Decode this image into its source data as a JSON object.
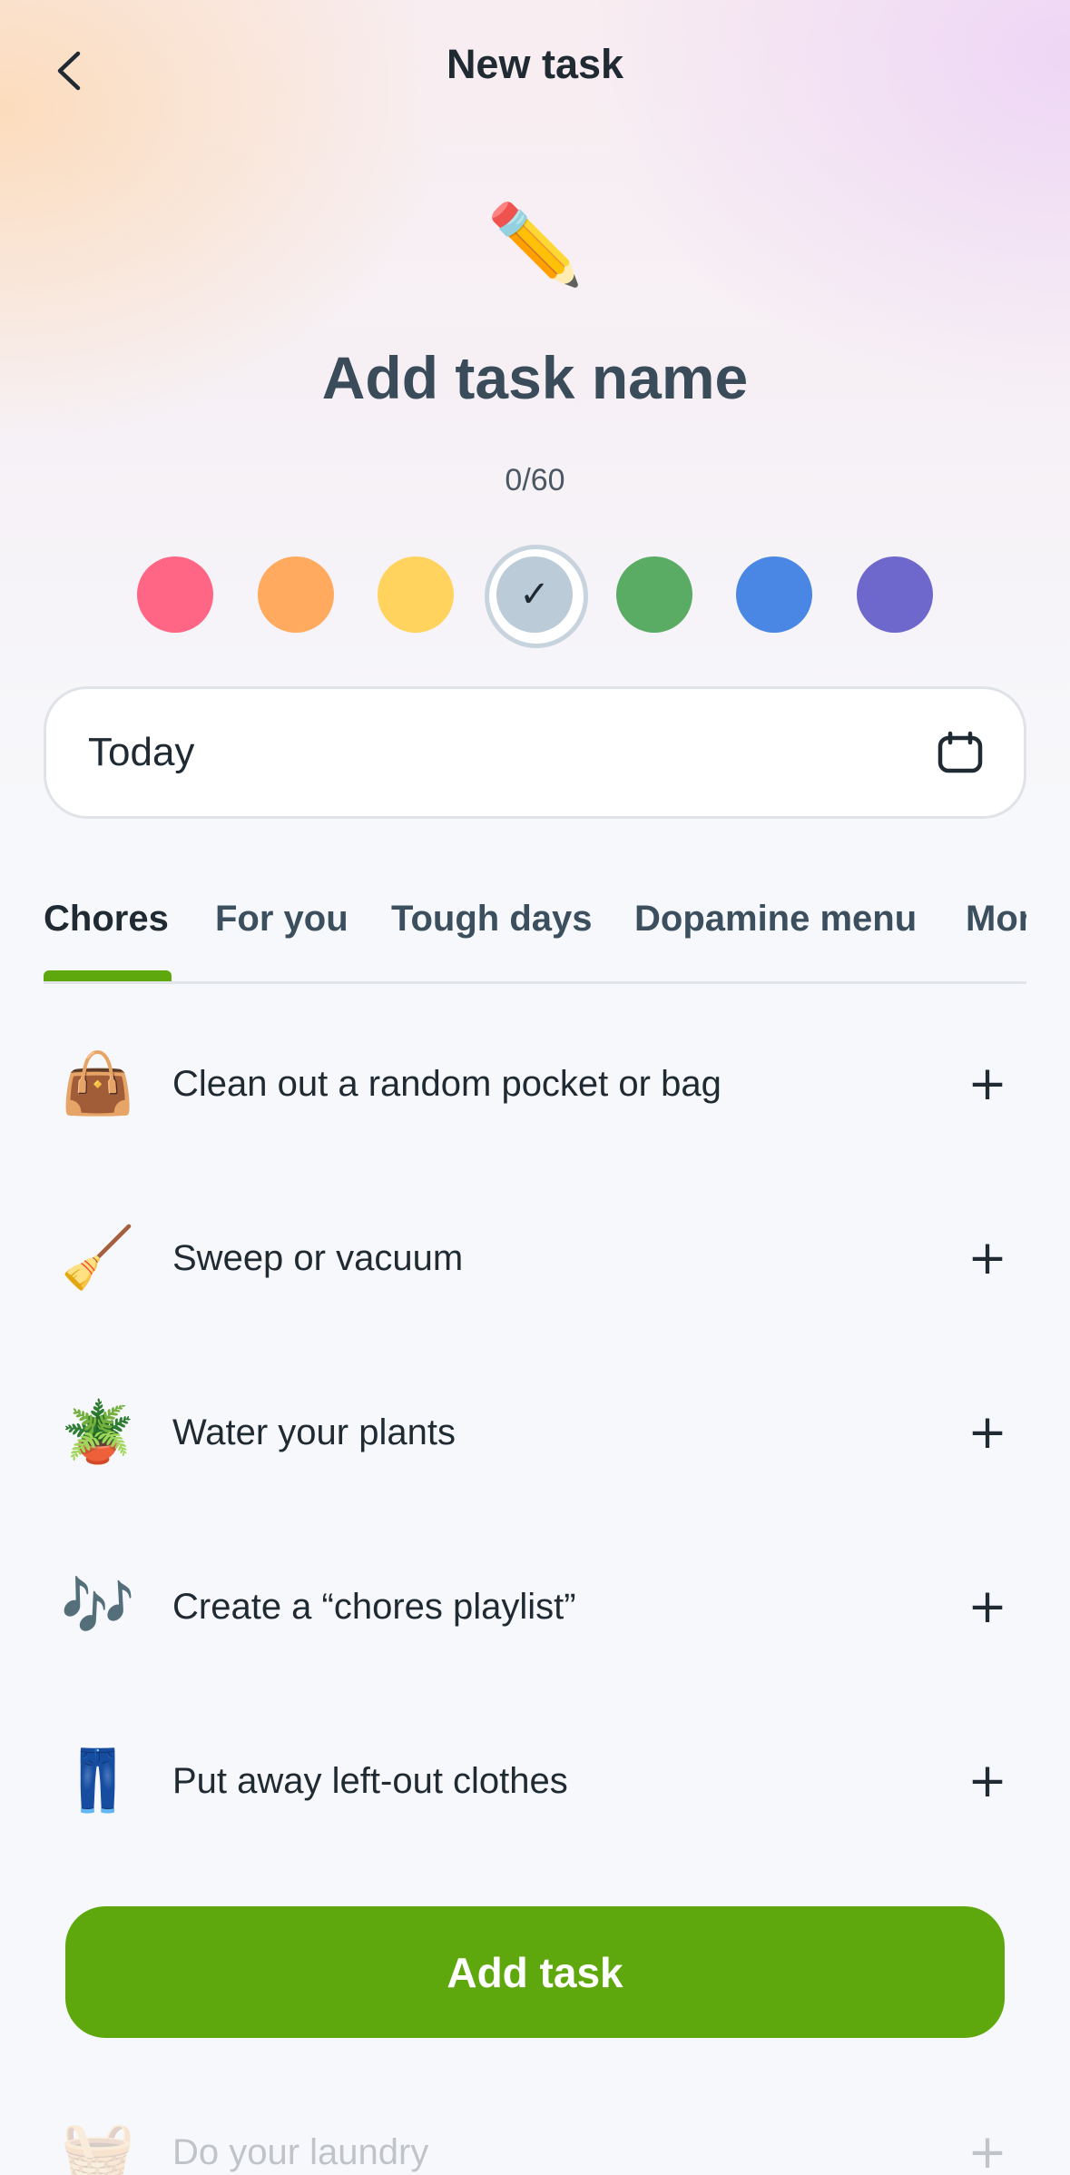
{
  "header": {
    "title": "New task",
    "back_icon": "chevron-left-icon"
  },
  "task": {
    "emoji": "✏️",
    "name_placeholder": "Add task name",
    "char_count": "0/60"
  },
  "colors": {
    "options": [
      "#ff6584",
      "#ffaa5e",
      "#ffd35e",
      "#bccbd8",
      "#5aac64",
      "#4a86e4",
      "#6e68cc"
    ],
    "selected_index": 3,
    "check_glyph": "✓"
  },
  "date": {
    "value": "Today",
    "icon": "calendar-icon"
  },
  "tabs": [
    {
      "label": "Chores",
      "active": true
    },
    {
      "label": "For you",
      "active": false
    },
    {
      "label": "Tough days",
      "active": false
    },
    {
      "label": "Dopamine menu",
      "active": false
    },
    {
      "label": "More",
      "active": false
    }
  ],
  "suggestions": [
    {
      "emoji": "👜",
      "label": "Clean out a random pocket or bag"
    },
    {
      "emoji": "🧹",
      "label": "Sweep or vacuum"
    },
    {
      "emoji": "🪴",
      "label": "Water your plants"
    },
    {
      "emoji": "🎶",
      "label": "Create a “chores playlist”"
    },
    {
      "emoji": "👖",
      "label": "Put away left-out clothes"
    },
    {
      "emoji": "🧺",
      "label": "Do your laundry"
    }
  ],
  "plus_glyph": "+",
  "add_button": {
    "label": "Add task",
    "color": "#5ea80e"
  }
}
